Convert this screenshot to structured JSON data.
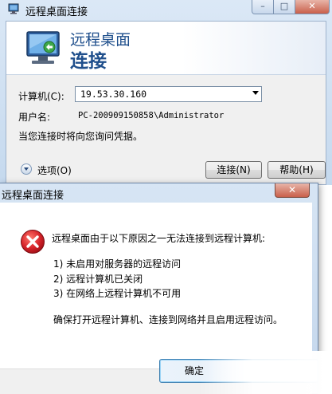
{
  "rdc_window": {
    "title": "远程桌面连接",
    "controls": {
      "minimize": "–",
      "maximize": "□",
      "close": "✕"
    },
    "banner": {
      "line1": "远程桌面",
      "line2": "连接"
    },
    "computer_label": "计算机(C):",
    "computer_value": "19.53.30.160",
    "username_label": "用户名:",
    "username_value": "PC-200909150858\\Administrator",
    "credential_note": "当您连接时将向您询问凭据。",
    "options_label": "选项(O)",
    "connect_button": "连接(N)",
    "help_button": "帮助(H)"
  },
  "error_dialog": {
    "title": "远程桌面连接",
    "close": "✕",
    "main_message": "远程桌面由于以下原因之一无法连接到远程计算机:",
    "reasons": [
      "1) 未启用对服务器的远程访问",
      "2) 远程计算机已关闭",
      "3) 在网络上远程计算机不可用"
    ],
    "advice": "确保打开远程计算机、连接到网络并且启用远程访问。",
    "ok_button": "确定"
  },
  "colors": {
    "banner_text": "#1f4f8c",
    "error_icon": "#c8102e",
    "close_button": "#c9604b",
    "frame": "#c5d9ee"
  }
}
